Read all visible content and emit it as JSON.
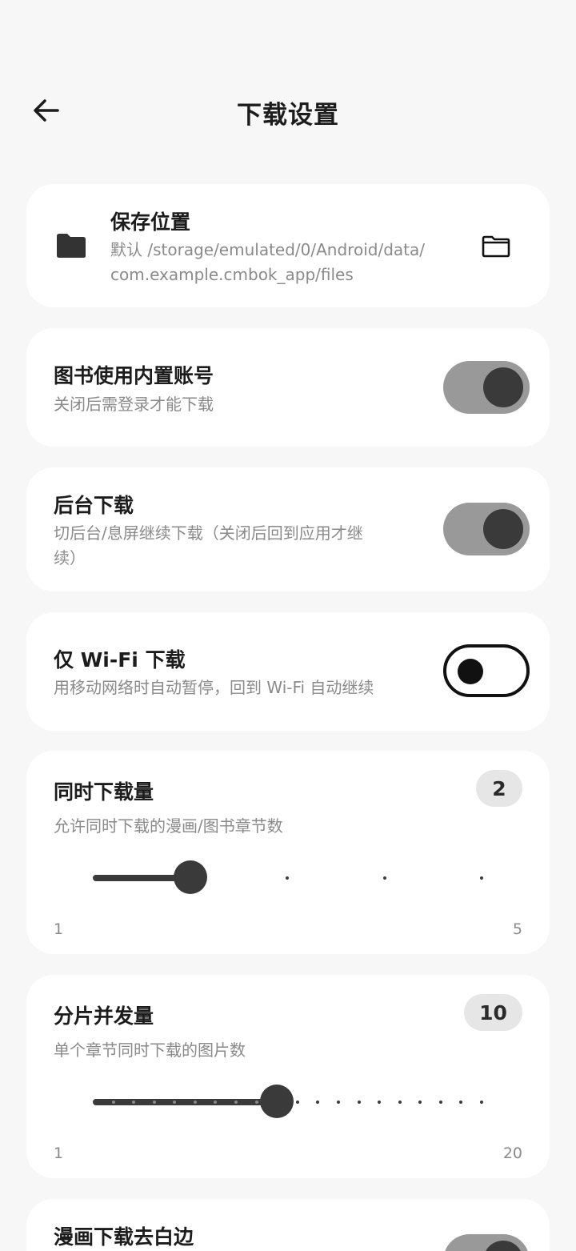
{
  "header": {
    "title": "下载设置"
  },
  "save_location": {
    "title": "保存位置",
    "path_line1": "默认 /storage/emulated/0/Android/data/",
    "path_line2": "com.example.cmbok_app/files"
  },
  "builtin_account": {
    "title": "图书使用内置账号",
    "subtitle": "关闭后需登录才能下载",
    "enabled": true
  },
  "background_download": {
    "title": "后台下载",
    "subtitle_line1": "切后台/息屏继续下载（关闭后回到应用才继",
    "subtitle_line2": "续）",
    "enabled": true
  },
  "wifi_only": {
    "title": "仅 Wi-Fi 下载",
    "subtitle": "用移动网络时自动暂停，回到 Wi-Fi 自动继续",
    "enabled": false
  },
  "concurrent_downloads": {
    "title": "同时下载量",
    "subtitle": "允许同时下载的漫画/图书章节数",
    "value": "2",
    "min": "1",
    "max": "5"
  },
  "chunk_concurrency": {
    "title": "分片并发量",
    "subtitle": "单个章节同时下载的图片数",
    "value": "10",
    "min": "1",
    "max": "20"
  },
  "trim_whitespace": {
    "title": "漫画下载去白边",
    "enabled": true
  },
  "colors": {
    "accent": "#3a3a3a",
    "switch_on_track": "#999999",
    "background": "#f7f7f7",
    "card": "#ffffff",
    "muted_text": "#8a8a8a"
  }
}
